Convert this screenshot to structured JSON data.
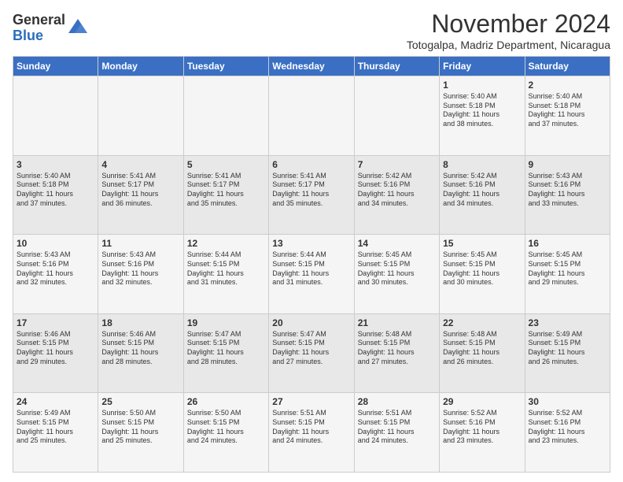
{
  "logo": {
    "general": "General",
    "blue": "Blue"
  },
  "header": {
    "month": "November 2024",
    "location": "Totogalpa, Madriz Department, Nicaragua"
  },
  "days_of_week": [
    "Sunday",
    "Monday",
    "Tuesday",
    "Wednesday",
    "Thursday",
    "Friday",
    "Saturday"
  ],
  "weeks": [
    [
      {
        "day": "",
        "info": ""
      },
      {
        "day": "",
        "info": ""
      },
      {
        "day": "",
        "info": ""
      },
      {
        "day": "",
        "info": ""
      },
      {
        "day": "",
        "info": ""
      },
      {
        "day": "1",
        "info": "Sunrise: 5:40 AM\nSunset: 5:18 PM\nDaylight: 11 hours\nand 38 minutes."
      },
      {
        "day": "2",
        "info": "Sunrise: 5:40 AM\nSunset: 5:18 PM\nDaylight: 11 hours\nand 37 minutes."
      }
    ],
    [
      {
        "day": "3",
        "info": "Sunrise: 5:40 AM\nSunset: 5:18 PM\nDaylight: 11 hours\nand 37 minutes."
      },
      {
        "day": "4",
        "info": "Sunrise: 5:41 AM\nSunset: 5:17 PM\nDaylight: 11 hours\nand 36 minutes."
      },
      {
        "day": "5",
        "info": "Sunrise: 5:41 AM\nSunset: 5:17 PM\nDaylight: 11 hours\nand 35 minutes."
      },
      {
        "day": "6",
        "info": "Sunrise: 5:41 AM\nSunset: 5:17 PM\nDaylight: 11 hours\nand 35 minutes."
      },
      {
        "day": "7",
        "info": "Sunrise: 5:42 AM\nSunset: 5:16 PM\nDaylight: 11 hours\nand 34 minutes."
      },
      {
        "day": "8",
        "info": "Sunrise: 5:42 AM\nSunset: 5:16 PM\nDaylight: 11 hours\nand 34 minutes."
      },
      {
        "day": "9",
        "info": "Sunrise: 5:43 AM\nSunset: 5:16 PM\nDaylight: 11 hours\nand 33 minutes."
      }
    ],
    [
      {
        "day": "10",
        "info": "Sunrise: 5:43 AM\nSunset: 5:16 PM\nDaylight: 11 hours\nand 32 minutes."
      },
      {
        "day": "11",
        "info": "Sunrise: 5:43 AM\nSunset: 5:16 PM\nDaylight: 11 hours\nand 32 minutes."
      },
      {
        "day": "12",
        "info": "Sunrise: 5:44 AM\nSunset: 5:15 PM\nDaylight: 11 hours\nand 31 minutes."
      },
      {
        "day": "13",
        "info": "Sunrise: 5:44 AM\nSunset: 5:15 PM\nDaylight: 11 hours\nand 31 minutes."
      },
      {
        "day": "14",
        "info": "Sunrise: 5:45 AM\nSunset: 5:15 PM\nDaylight: 11 hours\nand 30 minutes."
      },
      {
        "day": "15",
        "info": "Sunrise: 5:45 AM\nSunset: 5:15 PM\nDaylight: 11 hours\nand 30 minutes."
      },
      {
        "day": "16",
        "info": "Sunrise: 5:45 AM\nSunset: 5:15 PM\nDaylight: 11 hours\nand 29 minutes."
      }
    ],
    [
      {
        "day": "17",
        "info": "Sunrise: 5:46 AM\nSunset: 5:15 PM\nDaylight: 11 hours\nand 29 minutes."
      },
      {
        "day": "18",
        "info": "Sunrise: 5:46 AM\nSunset: 5:15 PM\nDaylight: 11 hours\nand 28 minutes."
      },
      {
        "day": "19",
        "info": "Sunrise: 5:47 AM\nSunset: 5:15 PM\nDaylight: 11 hours\nand 28 minutes."
      },
      {
        "day": "20",
        "info": "Sunrise: 5:47 AM\nSunset: 5:15 PM\nDaylight: 11 hours\nand 27 minutes."
      },
      {
        "day": "21",
        "info": "Sunrise: 5:48 AM\nSunset: 5:15 PM\nDaylight: 11 hours\nand 27 minutes."
      },
      {
        "day": "22",
        "info": "Sunrise: 5:48 AM\nSunset: 5:15 PM\nDaylight: 11 hours\nand 26 minutes."
      },
      {
        "day": "23",
        "info": "Sunrise: 5:49 AM\nSunset: 5:15 PM\nDaylight: 11 hours\nand 26 minutes."
      }
    ],
    [
      {
        "day": "24",
        "info": "Sunrise: 5:49 AM\nSunset: 5:15 PM\nDaylight: 11 hours\nand 25 minutes."
      },
      {
        "day": "25",
        "info": "Sunrise: 5:50 AM\nSunset: 5:15 PM\nDaylight: 11 hours\nand 25 minutes."
      },
      {
        "day": "26",
        "info": "Sunrise: 5:50 AM\nSunset: 5:15 PM\nDaylight: 11 hours\nand 24 minutes."
      },
      {
        "day": "27",
        "info": "Sunrise: 5:51 AM\nSunset: 5:15 PM\nDaylight: 11 hours\nand 24 minutes."
      },
      {
        "day": "28",
        "info": "Sunrise: 5:51 AM\nSunset: 5:15 PM\nDaylight: 11 hours\nand 24 minutes."
      },
      {
        "day": "29",
        "info": "Sunrise: 5:52 AM\nSunset: 5:16 PM\nDaylight: 11 hours\nand 23 minutes."
      },
      {
        "day": "30",
        "info": "Sunrise: 5:52 AM\nSunset: 5:16 PM\nDaylight: 11 hours\nand 23 minutes."
      }
    ]
  ]
}
